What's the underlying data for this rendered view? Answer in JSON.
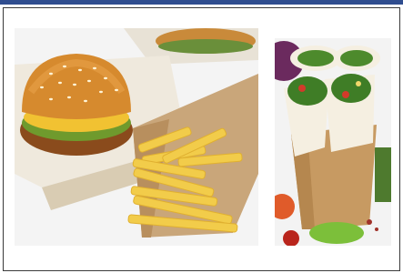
{
  "images": [
    {
      "name": "burger-and-fries-photo"
    },
    {
      "name": "wraps-photo"
    }
  ],
  "colors": {
    "header_bar": "#2f4d8f",
    "border": "#3a3a3a",
    "background": "#ffffff"
  }
}
